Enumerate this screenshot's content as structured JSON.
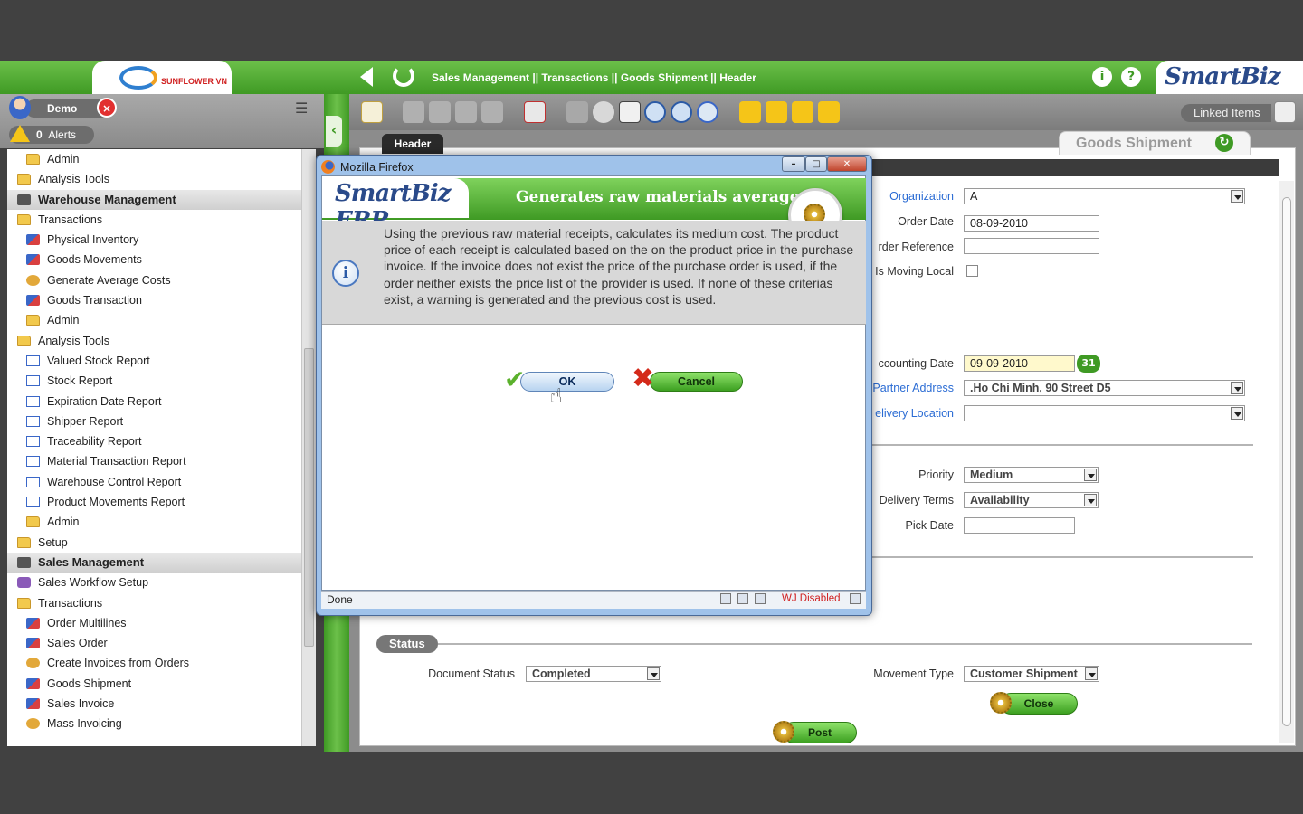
{
  "topbar": {
    "left_logo_text": "SUNFLOWER VN",
    "breadcrumb": "Sales Management || Transactions || Goods Shipment  ||  Header",
    "brand": "SmartBiz ERP",
    "info_icon": "i",
    "help_icon": "?"
  },
  "user": {
    "name": "Demo",
    "alerts_count": "0",
    "alerts_label": "Alerts"
  },
  "sidebar": {
    "items": [
      {
        "label": "Admin",
        "level": 1,
        "icon": "folder"
      },
      {
        "label": "Analysis Tools",
        "level": 0,
        "icon": "folder"
      },
      {
        "label": "Warehouse Management",
        "level": 0,
        "icon": "module",
        "section": true
      },
      {
        "label": "Transactions",
        "level": 0,
        "icon": "folder"
      },
      {
        "label": "Physical Inventory",
        "level": 1,
        "icon": "window"
      },
      {
        "label": "Goods Movements",
        "level": 1,
        "icon": "window"
      },
      {
        "label": "Generate Average Costs",
        "level": 1,
        "icon": "process"
      },
      {
        "label": "Goods Transaction",
        "level": 1,
        "icon": "window"
      },
      {
        "label": "Admin",
        "level": 1,
        "icon": "folder"
      },
      {
        "label": "Analysis Tools",
        "level": 0,
        "icon": "folder"
      },
      {
        "label": "Valued Stock Report",
        "level": 1,
        "icon": "report"
      },
      {
        "label": "Stock Report",
        "level": 1,
        "icon": "report"
      },
      {
        "label": "Expiration Date Report",
        "level": 1,
        "icon": "report"
      },
      {
        "label": "Shipper Report",
        "level": 1,
        "icon": "report"
      },
      {
        "label": "Traceability Report",
        "level": 1,
        "icon": "report"
      },
      {
        "label": "Material Transaction Report",
        "level": 1,
        "icon": "report"
      },
      {
        "label": "Warehouse Control Report",
        "level": 1,
        "icon": "report"
      },
      {
        "label": "Product Movements Report",
        "level": 1,
        "icon": "report"
      },
      {
        "label": "Admin",
        "level": 1,
        "icon": "folder"
      },
      {
        "label": "Setup",
        "level": 0,
        "icon": "folder"
      },
      {
        "label": "Sales Management",
        "level": 0,
        "icon": "module",
        "section": true
      },
      {
        "label": "Sales Workflow Setup",
        "level": 0,
        "icon": "setup"
      },
      {
        "label": "Transactions",
        "level": 0,
        "icon": "folder"
      },
      {
        "label": "Order Multilines",
        "level": 1,
        "icon": "window"
      },
      {
        "label": "Sales Order",
        "level": 1,
        "icon": "window"
      },
      {
        "label": "Create Invoices from Orders",
        "level": 1,
        "icon": "process"
      },
      {
        "label": "Goods Shipment",
        "level": 1,
        "icon": "window"
      },
      {
        "label": "Sales Invoice",
        "level": 1,
        "icon": "window"
      },
      {
        "label": "Mass Invoicing",
        "level": 1,
        "icon": "process"
      }
    ]
  },
  "toolbar": {
    "linked_items_label": "Linked Items"
  },
  "tabs": {
    "header": "Header",
    "window": "Goods Shipment"
  },
  "form": {
    "organization_label": "Organization",
    "organization_value": "A",
    "order_date_label": "Order Date",
    "order_date_value": "08-09-2010",
    "order_reference_label": "rder Reference",
    "order_reference_value": "",
    "is_moving_local_label": "Is Moving Local",
    "accounting_date_label": "ccounting Date",
    "accounting_date_value": "09-09-2010",
    "calendar_icon": "31",
    "partner_address_label": "Partner Address",
    "partner_address_value": ".Ho Chi Minh, 90 Street D5",
    "delivery_location_label": "elivery Location",
    "delivery_location_value": "",
    "priority_label": "Priority",
    "priority_value": "Medium",
    "delivery_terms_label": "Delivery Terms",
    "delivery_terms_value": "Availability",
    "pick_date_label": "Pick Date",
    "pick_date_value": "",
    "status_section": "Status",
    "document_status_label": "Document Status",
    "document_status_value": "Completed",
    "movement_type_label": "Movement Type",
    "movement_type_value": "Customer Shipment",
    "close_button": "Close",
    "post_button": "Post"
  },
  "dialog": {
    "window_title": "Mozilla Firefox",
    "brand": "SmartBiz ERP",
    "process_title": "Generates raw materials average cost",
    "help_text": "Using the previous raw material receipts, calculates its medium cost. The product price of each receipt is calculated based on the on the product price in the purchase invoice. If the invoice does not exist the price of the purchase order is used, if the order neither exists the price list of the provider is used. If none of these criterias exist, a warning is generated and the previous cost is used.",
    "info_icon": "i",
    "ok_label": "OK",
    "cancel_label": "Cancel",
    "status_text": "Done",
    "status_right": "WJ Disabled",
    "min_glyph": "–",
    "max_glyph": "□",
    "close_glyph": "✕"
  },
  "colors": {
    "brand_green": "#3f9a24",
    "link_blue": "#2b6cd4",
    "dialog_frame": "#9fc2ea"
  }
}
